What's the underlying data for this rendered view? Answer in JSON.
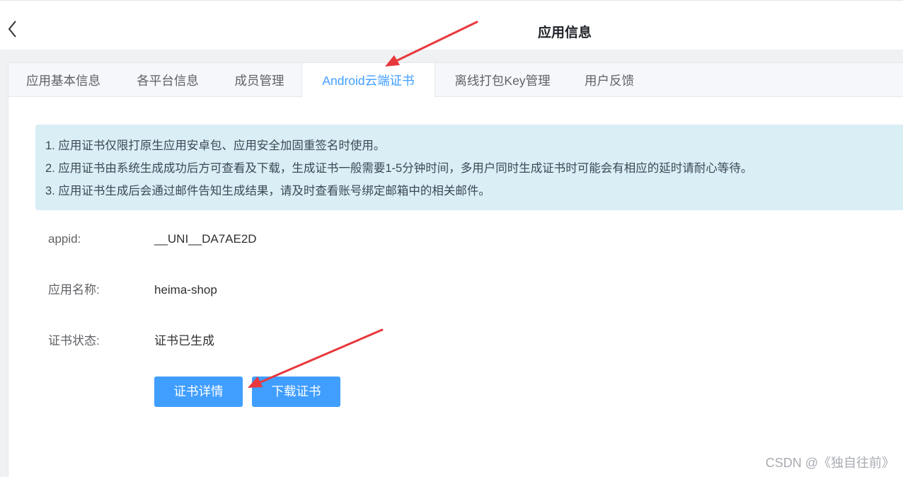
{
  "header": {
    "title": "应用信息",
    "back_icon": "chevron-left-icon"
  },
  "tabs": [
    {
      "label": "应用基本信息",
      "active": false
    },
    {
      "label": "各平台信息",
      "active": false
    },
    {
      "label": "成员管理",
      "active": false
    },
    {
      "label": "Android云端证书",
      "active": true
    },
    {
      "label": "离线打包Key管理",
      "active": false
    },
    {
      "label": "用户反馈",
      "active": false
    }
  ],
  "notice": {
    "lines": [
      "1. 应用证书仅限打原生应用安卓包、应用安全加固重签名时使用。",
      "2. 应用证书由系统生成成功后方可查看及下载，生成证书一般需要1-5分钟时间，多用户同时生成证书时可能会有相应的延时请耐心等待。",
      "3. 应用证书生成后会通过邮件告知生成结果，请及时查看账号绑定邮箱中的相关邮件。"
    ]
  },
  "details": {
    "appid_label": "appid:",
    "appid_value": "__UNI__DA7AE2D",
    "name_label": "应用名称:",
    "name_value": "heima-shop",
    "status_label": "证书状态:",
    "status_value": "证书已生成"
  },
  "actions": {
    "details_button": "证书详情",
    "download_button": "下载证书"
  },
  "watermark": "CSDN @《独自往前》",
  "colors": {
    "accent": "#409eff",
    "notice_bg": "#daeef6",
    "annotation_arrow": "#e8383d"
  }
}
